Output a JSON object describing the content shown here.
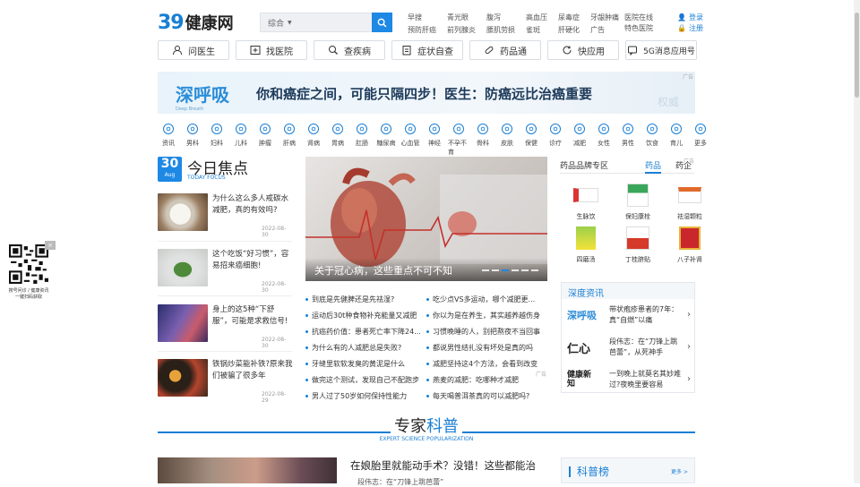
{
  "header": {
    "logo_num": "39",
    "logo_text": "健康网",
    "search_scope": "综合",
    "hot_links": [
      "早搜",
      "青光眼",
      "腹泻",
      "高血压",
      "尿毒症",
      "牙龈肿痛",
      "预防肝癌",
      "前列腺炎",
      "腰肌劳损",
      "雀斑",
      "肝硬化",
      "广告"
    ],
    "hospital_links": [
      "医院在线",
      "特色医院"
    ],
    "login": "登录",
    "register": "注册"
  },
  "nav": {
    "items": [
      "问医生",
      "找医院",
      "查疾病",
      "症状自查",
      "药品通",
      "快应用",
      "5G消息应用号"
    ]
  },
  "banner": {
    "brand": "深呼吸",
    "brand_en": "Deep Breath",
    "headline": "你和癌症之间，可能只隔四步！医生：防癌远比治癌重要",
    "watermark": "权威",
    "ad": "广告"
  },
  "categories": [
    "资讯",
    "男科",
    "妇科",
    "儿科",
    "肿瘤",
    "肝病",
    "肾病",
    "胃病",
    "肛肠",
    "糖尿病",
    "心血管",
    "神经",
    "不孕不育",
    "骨科",
    "皮肤",
    "保健",
    "诊疗",
    "减肥",
    "女性",
    "男性",
    "饮食",
    "育儿",
    "更多"
  ],
  "focus": {
    "day": "30",
    "month": "Aug",
    "title": "今日焦点",
    "subtitle": "TODAY FOCUS",
    "items": [
      {
        "text": "为什么这么多人戒碳水减肥，真的有效吗?",
        "date": "2022-08-30"
      },
      {
        "text": "这个吃饭“好习惯”，容易招来癌细胞!",
        "date": "2022-08-30"
      },
      {
        "text": "身上的这5种“下舒服”，可能是求救信号!",
        "date": "2022-08-30"
      },
      {
        "text": "铁锅炒菜能补铁?原来我们被骗了很多年",
        "date": "2022-08-29"
      }
    ]
  },
  "hero": {
    "caption": "关于冠心病，这些重点不可不知"
  },
  "links": [
    [
      "到底是先健脾还是先祛湿?",
      "吃少点VS多运动，哪个减肥更..."
    ],
    [
      "运动后30t种食物补充能量又减肥",
      "你以为是在养生，其实越养越伤身"
    ],
    [
      "抗癌药价值：患者死亡率下降24...",
      "习惯晚睡的人，别把熬夜不当回事"
    ],
    [
      "为什么有的人减肥总是失败?",
      "都说男性结扎没有坏处是真的吗"
    ],
    [
      "牙缝里软软发臭的黄泥是什么",
      "减肥坚持这4个方法，会看到改变"
    ],
    [
      "做完这个测试，发现自己不配跑步",
      "燕麦的减肥：吃哪种才减肥"
    ],
    [
      "男人过了50岁如何保持性能力",
      "每天喝普洱茶真的可以减肥吗?"
    ]
  ],
  "links_ad": "广告",
  "drug_panel": {
    "title": "药品品牌专区",
    "tab_active": "药品",
    "tab_other": "药企",
    "ad": "广告",
    "drugs": [
      "生脉饮",
      "保妇康栓",
      "祛湿颗粒",
      "四磨汤",
      "丁桂脐贴",
      "八子补肾"
    ]
  },
  "deep_news": {
    "title": "深度资讯",
    "items": [
      {
        "icon": "深呼吸",
        "text": "带状疱疹患者的7年：真“自燃”以痛"
      },
      {
        "icon": "仁心",
        "text": "段伟志：在“刀锋上跳芭蕾”，从死神手"
      },
      {
        "icon": "健康新知",
        "text": "一到晚上就莫名其妙难过?夜晚里要容易"
      }
    ]
  },
  "expert": {
    "title_a": "专家",
    "title_b": "科普",
    "subtitle": "EXPERT SCIENCE POPULARIZATION",
    "headline": "在娘胎里就能动手术？没错！这些都能治",
    "sub": "段伟志：在“刀锋上跳芭蕾”"
  },
  "kepu": {
    "title": "科普榜",
    "more": "更多 >"
  },
  "qr": {
    "line1": "搜号问诊 / 健康资讯",
    "line2": "一键扫码获取",
    "close": "×"
  }
}
